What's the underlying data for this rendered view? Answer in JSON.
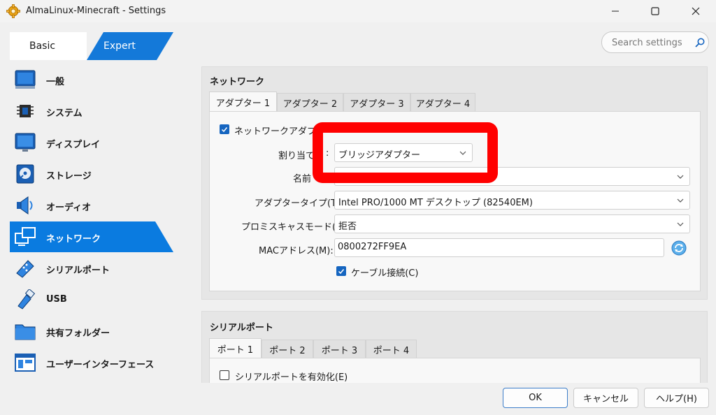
{
  "window": {
    "title": "AlmaLinux-Minecraft - Settings",
    "app_icon": "gear-icon",
    "controls": [
      "minimize-icon",
      "maximize-icon",
      "close-icon"
    ]
  },
  "mode": {
    "basic_label": "Basic",
    "expert_label": "Expert",
    "selected": "Expert"
  },
  "search": {
    "placeholder": "Search settings"
  },
  "sidebar": {
    "items": [
      {
        "label": "一般",
        "icon": "general-icon"
      },
      {
        "label": "システム",
        "icon": "system-chip-icon"
      },
      {
        "label": "ディスプレイ",
        "icon": "display-icon"
      },
      {
        "label": "ストレージ",
        "icon": "storage-disc-icon"
      },
      {
        "label": "オーディオ",
        "icon": "audio-speaker-icon"
      },
      {
        "label": "ネットワーク",
        "icon": "network-icon"
      },
      {
        "label": "シリアルポート",
        "icon": "serial-port-icon"
      },
      {
        "label": "USB",
        "icon": "usb-icon"
      },
      {
        "label": "共有フォルダー",
        "icon": "shared-folder-icon"
      },
      {
        "label": "ユーザーインターフェース",
        "icon": "user-interface-icon"
      }
    ],
    "selected": "ネットワーク"
  },
  "network": {
    "title": "ネットワーク",
    "tabs": [
      "アダプター 1",
      "アダプター 2",
      "アダプター 3",
      "アダプター 4"
    ],
    "selected_tab": "アダプター 1",
    "enable_adapter_label": "ネットワークアダプター",
    "enable_adapter_checked": true,
    "attached_to_label": "割り当て",
    "attached_to_label_tail": ":",
    "attached_to_value": "ブリッジアダプター",
    "name_label": "名前",
    "name_value": "",
    "adapter_type_label": "アダプタータイプ(T):",
    "adapter_type_value": "Intel PRO/1000 MT デスクトップ (82540EM)",
    "promiscuous_label": "プロミスキャスモード(P):",
    "promiscuous_value": "拒否",
    "mac_label": "MACアドレス(M):",
    "mac_value": "0800272FF9EA",
    "cable_label": "ケーブル接続(C)",
    "cable_checked": true,
    "highlight_color": "#ff0000"
  },
  "serial": {
    "title": "シリアルポート",
    "tabs": [
      "ポート 1",
      "ポート 2",
      "ポート 3",
      "ポート 4"
    ],
    "selected_tab": "ポート 1",
    "enable_label": "シリアルポートを有効化(E)",
    "enable_checked": false
  },
  "buttons": {
    "ok": "OK",
    "cancel": "キャンセル",
    "help": "ヘルプ(H)"
  },
  "colors": {
    "accent": "#0078d4",
    "checkbox": "#1565c0"
  }
}
